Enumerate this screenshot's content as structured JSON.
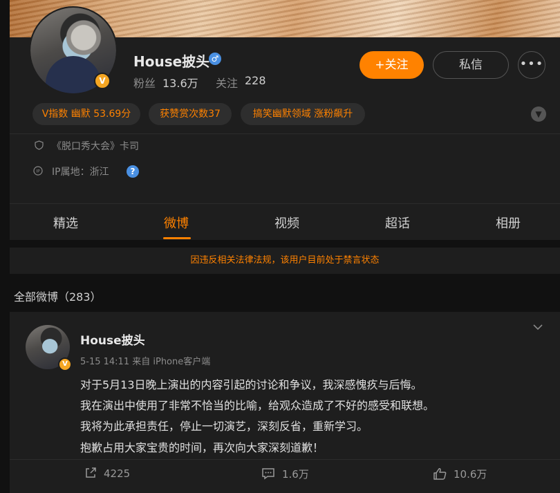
{
  "profile": {
    "name": "House披头",
    "gender_icon": "male-icon",
    "verified_badge": "V",
    "fans_label": "粉丝",
    "fans_value": "13.6万",
    "follow_label": "关注",
    "follow_value": "228",
    "follow_button": "+关注",
    "message_button": "私信",
    "more_button": "•••"
  },
  "tags": [
    "V指数 幽默 53.69分",
    "获赞赏次数37",
    "搞笑幽默领域 涨粉飙升"
  ],
  "info": {
    "verify_text": "《脱口秀大会》卡司",
    "ip_text": "IP属地：浙江",
    "help_icon": "?"
  },
  "tabs": [
    "精选",
    "微博",
    "视频",
    "超话",
    "相册"
  ],
  "active_tab": "微博",
  "notice": "因违反相关法律法规，该用户目前处于禁言状态",
  "all_posts_label": "全部微博（283）",
  "post": {
    "author": "House披头",
    "meta": "5-15 14:11  来自 iPhone客户端",
    "lines": [
      "对于5月13日晚上演出的内容引起的讨论和争议，我深感愧疚与后悔。",
      "我在演出中使用了非常不恰当的比喻，给观众造成了不好的感受和联想。",
      "我将为此承担责任，停止一切演艺，深刻反省，重新学习。",
      "抱歉占用大家宝贵的时间，再次向大家深刻道歉！"
    ],
    "reposts": "4225",
    "comments": "1.6万",
    "likes": "10.6万"
  },
  "colors": {
    "accent": "#ff8200",
    "background": "#111111",
    "card": "#1e1e1e",
    "link_blue": "#4a90e2"
  }
}
